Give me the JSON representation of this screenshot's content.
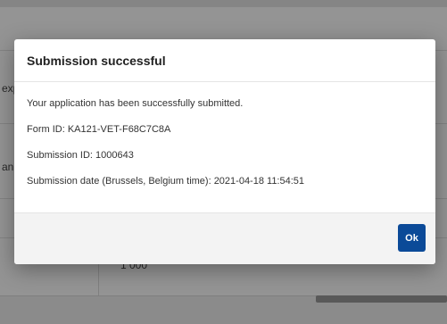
{
  "background": {
    "left_cells": [
      "exp",
      "an"
    ],
    "amount_fragment": "1 000"
  },
  "modal": {
    "title": "Submission successful",
    "message": "Your application has been successfully submitted.",
    "form_id": "Form ID: KA121-VET-F68C7C8A",
    "submission_id": "Submission ID: 1000643",
    "submission_date": "Submission date (Brussels, Belgium time): 2021-04-18 11:54:51",
    "ok_label": "Ok"
  },
  "colors": {
    "primary_button": "#0b4a98",
    "overlay": "rgba(0,0,0,0.42)"
  }
}
